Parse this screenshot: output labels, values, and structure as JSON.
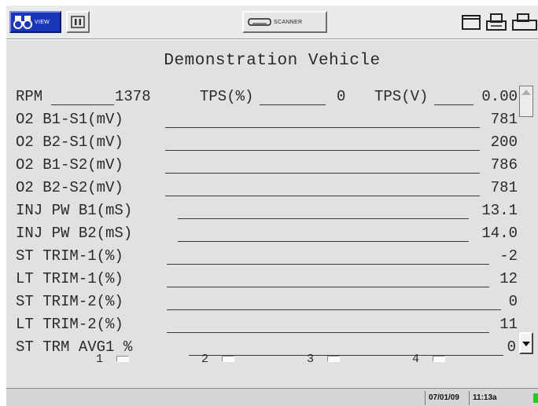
{
  "toolbar": {
    "view_label": "VIEW",
    "scanner_label": "SCANNER"
  },
  "panel": {
    "title": "Demonstration Vehicle",
    "top_row": {
      "rpm_label": "RPM",
      "rpm_value": "1378",
      "tps_pct_label": "TPS(%)",
      "tps_pct_value": "0",
      "tps_v_label": "TPS(V)",
      "tps_v_value": "0.00"
    },
    "rows": [
      {
        "label": "O2 B1-S1(mV)",
        "value": "781"
      },
      {
        "label": "O2 B2-S1(mV)",
        "value": "200"
      },
      {
        "label": "O2 B1-S2(mV)",
        "value": "786"
      },
      {
        "label": "O2 B2-S2(mV)",
        "value": "781"
      },
      {
        "label": "INJ PW B1(mS)",
        "value": "13.1"
      },
      {
        "label": "INJ PW B2(mS)",
        "value": "14.0"
      },
      {
        "label": "ST TRIM-1(%)",
        "value": "-2"
      },
      {
        "label": "LT TRIM-1(%)",
        "value": "12"
      },
      {
        "label": "ST TRIM-2(%)",
        "value": "0"
      },
      {
        "label": "LT TRIM-2(%)",
        "value": "11"
      },
      {
        "label": "ST TRM AVG1 %",
        "value": "0"
      }
    ]
  },
  "soft_keys": [
    "1",
    "2",
    "3",
    "4"
  ],
  "status": {
    "date": "07/01/09",
    "time": "11:13a"
  },
  "colors": {
    "view_button": "#1b37b8",
    "panel_bg": "#e1e1e1",
    "status_led": "#22cc22"
  }
}
